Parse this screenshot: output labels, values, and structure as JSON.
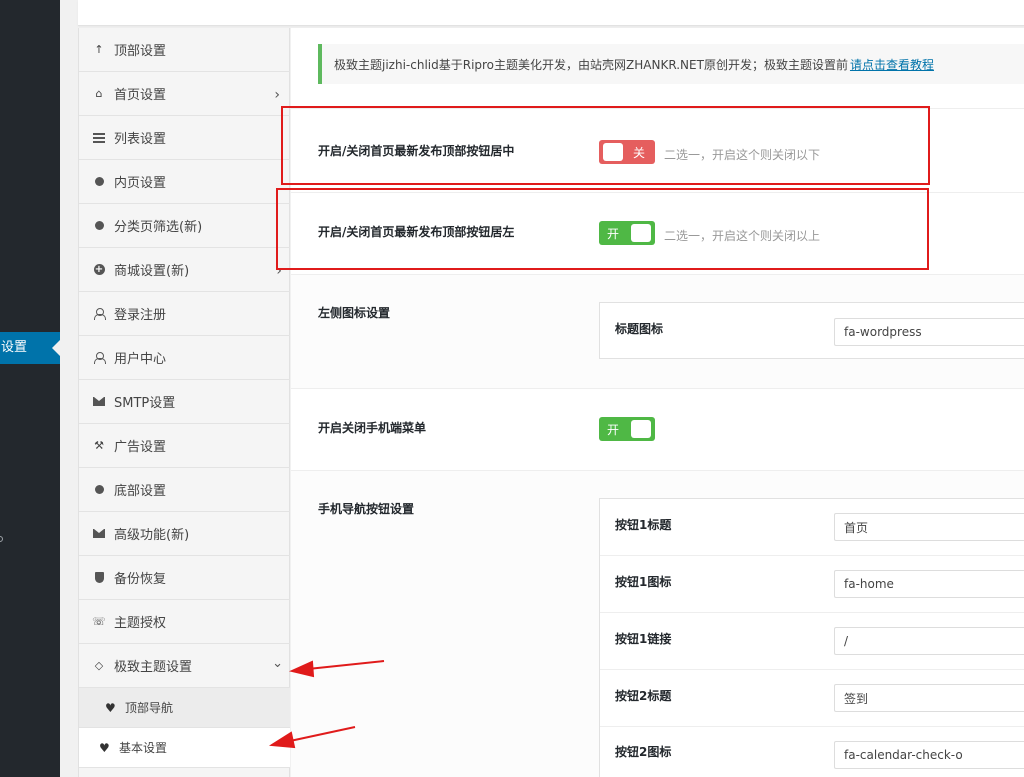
{
  "wp_admin": {
    "active_item_label": "设置"
  },
  "nav": {
    "items": [
      {
        "label": "顶部设置",
        "icon": "arrow-up-icon"
      },
      {
        "label": "首页设置",
        "icon": "home-icon"
      },
      {
        "label": "列表设置",
        "icon": "list-icon"
      },
      {
        "label": "内页设置",
        "icon": "dot-icon"
      },
      {
        "label": "分类页筛选(新)",
        "icon": "dot-icon"
      },
      {
        "label": "商城设置(新)",
        "icon": "plus-circle-icon"
      },
      {
        "label": "登录注册",
        "icon": "user-icon"
      },
      {
        "label": "用户中心",
        "icon": "user-icon"
      },
      {
        "label": "SMTP设置",
        "icon": "envelope-icon"
      },
      {
        "label": "广告设置",
        "icon": "gavel-icon"
      },
      {
        "label": "底部设置",
        "icon": "dot-icon"
      },
      {
        "label": "高级功能(新)",
        "icon": "envelope-icon"
      },
      {
        "label": "备份恢复",
        "icon": "shield-icon"
      },
      {
        "label": "主题授权",
        "icon": "handshake-icon"
      },
      {
        "label": "极致主题设置",
        "icon": "diamond-icon"
      }
    ],
    "subitems": [
      {
        "label": "顶部导航",
        "icon": "heart-icon"
      },
      {
        "label": "基本设置",
        "icon": "heart-icon"
      }
    ]
  },
  "notice": {
    "text": "极致主题jizhi-chlid基于Ripro主题美化开发，由站壳网ZHANKR.NET原创开发；极致主题设置前",
    "link": "请点击查看教程"
  },
  "settings": {
    "center_button": {
      "label": "开启/关闭首页最新发布顶部按钮居中",
      "toggle": "关",
      "state": "off",
      "hint": "二选一，开启这个则关闭以下"
    },
    "left_button": {
      "label": "开启/关闭首页最新发布顶部按钮居左",
      "toggle": "开",
      "state": "on",
      "hint": "二选一，开启这个则关闭以上"
    },
    "left_icon": {
      "label": "左侧图标设置",
      "field_label": "标题图标",
      "field_value": "fa-wordpress"
    },
    "mobile_menu": {
      "label": "开启关闭手机端菜单",
      "toggle": "开",
      "state": "on"
    },
    "mobile_nav": {
      "label": "手机导航按钮设置",
      "rows": [
        {
          "label": "按钮1标题",
          "value": "首页"
        },
        {
          "label": "按钮1图标",
          "value": "fa-home"
        },
        {
          "label": "按钮1链接",
          "value": "/"
        },
        {
          "label": "按钮2标题",
          "value": "签到"
        },
        {
          "label": "按钮2图标",
          "value": "fa-calendar-check-o"
        }
      ]
    }
  },
  "colors": {
    "toggle_on": "#4fb845",
    "toggle_off": "#e55e5e",
    "annotation_red": "#e01b1b",
    "notice_border": "#5eb95e",
    "wp_blue": "#0073aa"
  }
}
